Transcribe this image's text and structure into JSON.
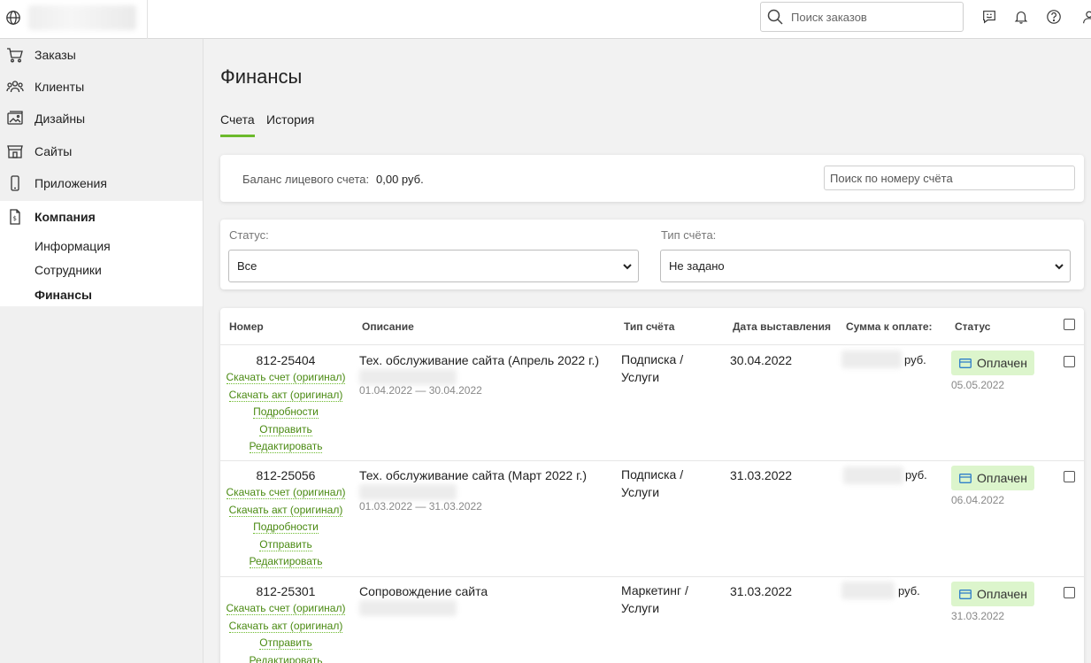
{
  "topbar": {
    "globe_icon": "globe-icon",
    "search_placeholder": "Поиск заказов",
    "icons": [
      "chat-icon",
      "bell-icon",
      "help-icon",
      "user-icon"
    ]
  },
  "sidebar": {
    "items": [
      {
        "label": "Заказы",
        "icon": "cart-icon"
      },
      {
        "label": "Клиенты",
        "icon": "users-icon"
      },
      {
        "label": "Дизайны",
        "icon": "image-icon"
      },
      {
        "label": "Сайты",
        "icon": "store-icon"
      },
      {
        "label": "Приложения",
        "icon": "phone-icon"
      },
      {
        "label": "Компания",
        "icon": "document-icon"
      }
    ],
    "sub_items": [
      "Информация",
      "Сотрудники",
      "Финансы"
    ]
  },
  "page": {
    "title": "Финансы",
    "tabs": [
      "Счета",
      "История"
    ]
  },
  "balance": {
    "label": "Баланс лицевого счета:",
    "value": "0,00 руб.",
    "search_placeholder": "Поиск по номеру счёта"
  },
  "filters": {
    "status_label": "Статус:",
    "status_value": "Все",
    "type_label": "Тип счёта:",
    "type_value": "Не задано"
  },
  "table": {
    "headers": [
      "Номер",
      "Описание",
      "Тип счёта",
      "Дата выставления",
      "Сумма к оплате:",
      "Статус"
    ],
    "rows": [
      {
        "number": "812-25404",
        "links": [
          "Скачать счет (оригинал)",
          "Скачать акт (оригинал)",
          "Подробности",
          "Отправить",
          "Редактировать"
        ],
        "description": "Тех. обслуживание сайта (Апрель 2022 г.)",
        "period": "01.04.2022 — 30.04.2022",
        "type_line1": "Подписка /",
        "type_line2": "Услуги",
        "date": "30.04.2022",
        "currency": "руб.",
        "status": "Оплачен",
        "status_date": "05.05.2022"
      },
      {
        "number": "812-25056",
        "links": [
          "Скачать счет (оригинал)",
          "Скачать акт (оригинал)",
          "Подробности",
          "Отправить",
          "Редактировать"
        ],
        "description": "Тех. обслуживание сайта (Март 2022 г.)",
        "period": "01.03.2022 — 31.03.2022",
        "type_line1": "Подписка /",
        "type_line2": "Услуги",
        "date": "31.03.2022",
        "currency": "руб.",
        "status": "Оплачен",
        "status_date": "06.04.2022"
      },
      {
        "number": "812-25301",
        "links": [
          "Скачать счет (оригинал)",
          "Скачать акт (оригинал)",
          "Отправить",
          "Редактировать"
        ],
        "description": "Сопровождение сайта",
        "period": "",
        "type_line1": "Маркетинг /",
        "type_line2": "Услуги",
        "date": "31.03.2022",
        "currency": "руб.",
        "status": "Оплачен",
        "status_date": "31.03.2022"
      }
    ]
  },
  "colors": {
    "accent": "#6cba2c",
    "link": "#4a8a12",
    "badge_bg": "#dcf5cc",
    "card_icon": "#2f7fc9"
  }
}
